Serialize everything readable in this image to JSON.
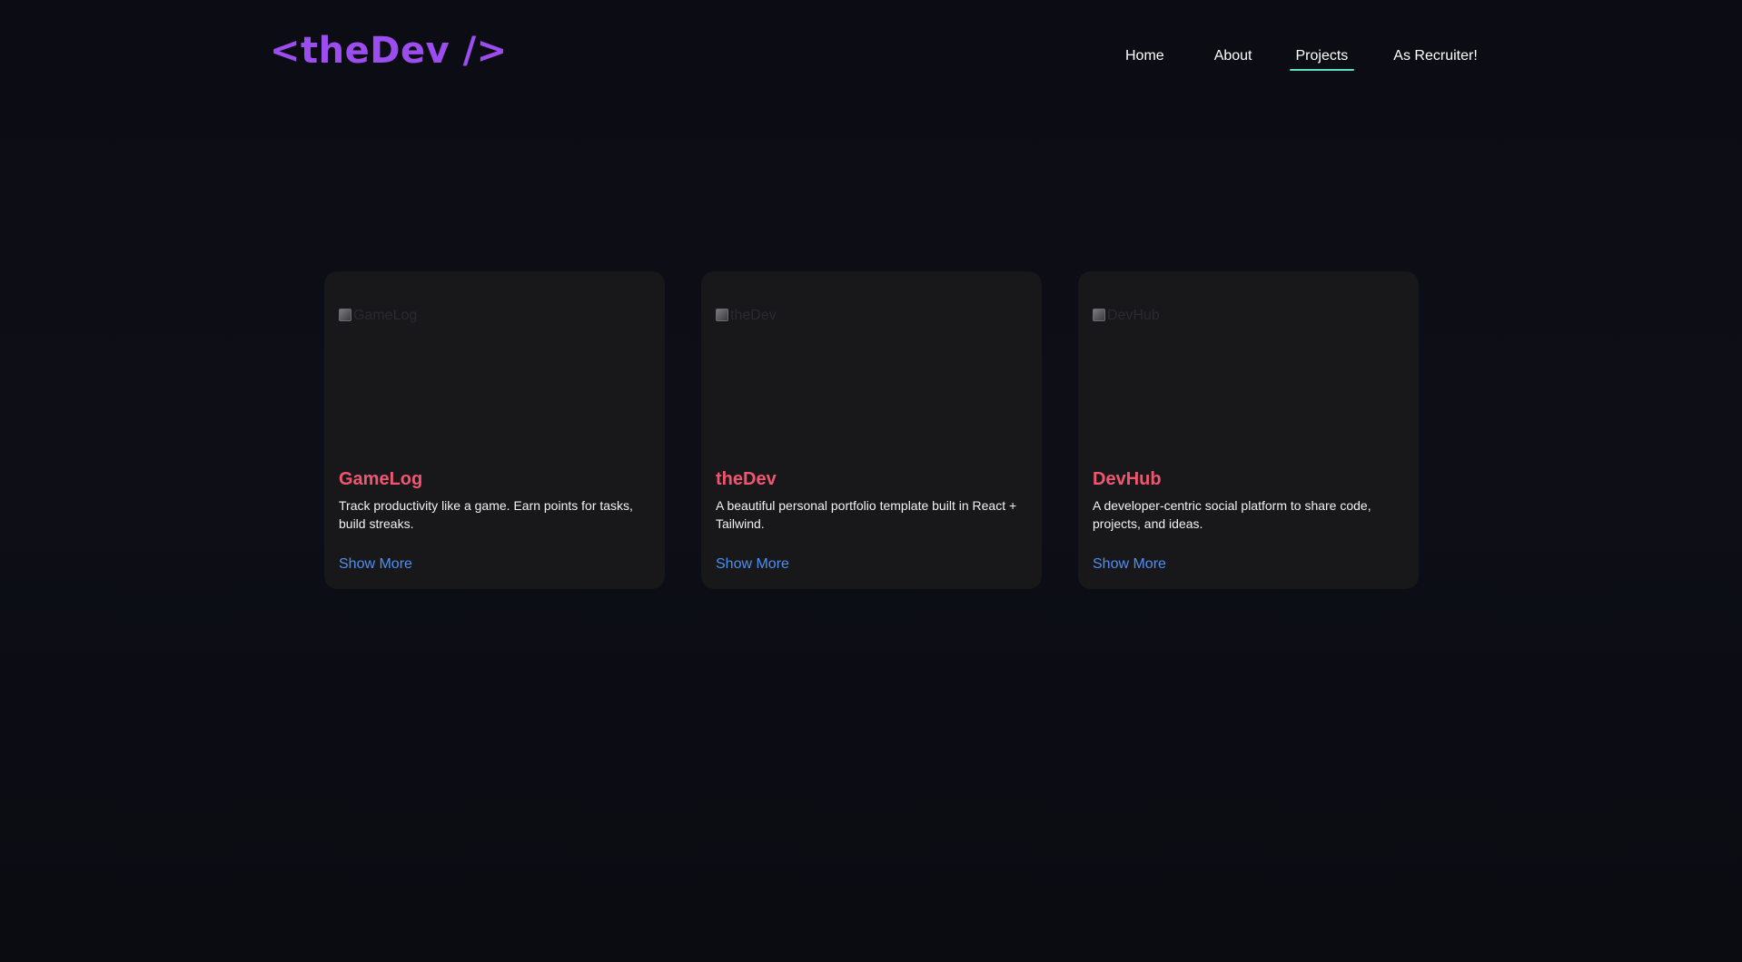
{
  "brand": {
    "logo_text": "<theDev />",
    "accent_color": "#9b4dee"
  },
  "nav": {
    "items": [
      {
        "label": "Home"
      },
      {
        "label": "About"
      },
      {
        "label": "Projects",
        "active": true
      },
      {
        "label": "As Recruiter!"
      }
    ],
    "active_underline_color": "#5ce1c3"
  },
  "projects": [
    {
      "title": "GameLog",
      "image_alt": "GameLog",
      "description": "Track productivity like a game. Earn points for tasks, build streaks.",
      "link_label": "Show More"
    },
    {
      "title": "theDev",
      "image_alt": "theDev",
      "description": "A beautiful personal portfolio template built in React + Tailwind.",
      "link_label": "Show More"
    },
    {
      "title": "DevHub",
      "image_alt": "DevHub",
      "description": "A developer-centric social platform to share code, projects, and ideas.",
      "link_label": "Show More"
    }
  ],
  "colors": {
    "title": "#f0566f",
    "link": "#4f8ff0",
    "card_bg": "#18181b"
  }
}
